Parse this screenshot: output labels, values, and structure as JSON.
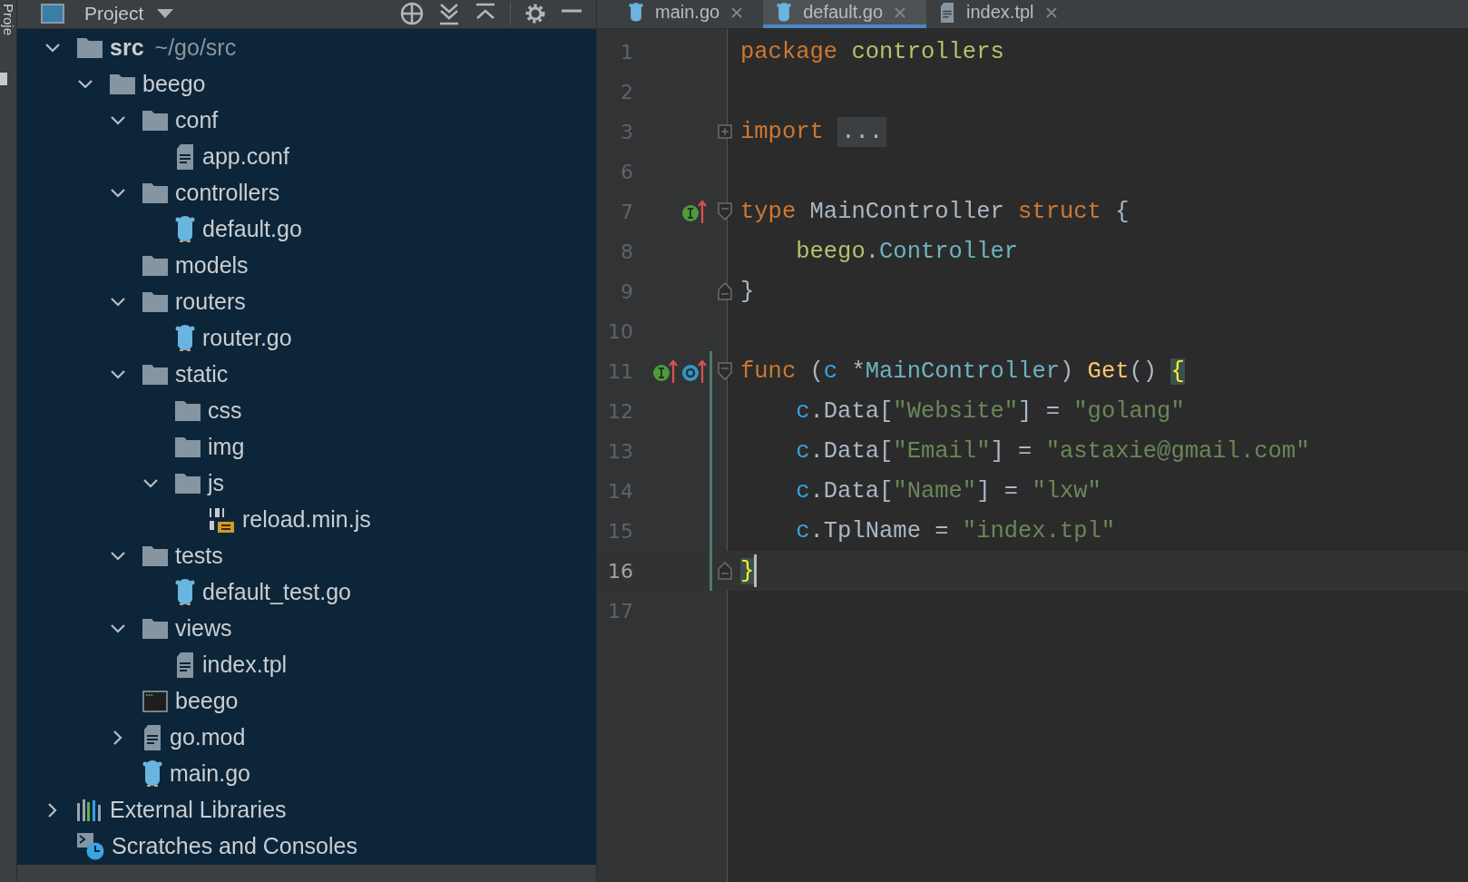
{
  "side_tab": {
    "label": "Proje"
  },
  "project_header": {
    "title": "Project"
  },
  "tree": [
    {
      "name": "src",
      "path": "~/go/src",
      "kind": "folder",
      "expanded": true,
      "children": [
        {
          "name": "beego",
          "kind": "folder",
          "expanded": true,
          "children": [
            {
              "name": "conf",
              "kind": "folder",
              "expanded": true,
              "children": [
                {
                  "name": "app.conf",
                  "kind": "text"
                }
              ]
            },
            {
              "name": "controllers",
              "kind": "folder",
              "expanded": true,
              "children": [
                {
                  "name": "default.go",
                  "kind": "go"
                }
              ]
            },
            {
              "name": "models",
              "kind": "folder"
            },
            {
              "name": "routers",
              "kind": "folder",
              "expanded": true,
              "children": [
                {
                  "name": "router.go",
                  "kind": "go"
                }
              ]
            },
            {
              "name": "static",
              "kind": "folder",
              "expanded": true,
              "children": [
                {
                  "name": "css",
                  "kind": "folder"
                },
                {
                  "name": "img",
                  "kind": "folder"
                },
                {
                  "name": "js",
                  "kind": "folder",
                  "expanded": true,
                  "children": [
                    {
                      "name": "reload.min.js",
                      "kind": "binary"
                    }
                  ]
                }
              ]
            },
            {
              "name": "tests",
              "kind": "folder",
              "expanded": true,
              "children": [
                {
                  "name": "default_test.go",
                  "kind": "go"
                }
              ]
            },
            {
              "name": "views",
              "kind": "folder",
              "expanded": true,
              "children": [
                {
                  "name": "index.tpl",
                  "kind": "text"
                }
              ]
            },
            {
              "name": "beego",
              "kind": "executable"
            },
            {
              "name": "go.mod",
              "kind": "text",
              "expanded": false
            },
            {
              "name": "main.go",
              "kind": "go"
            }
          ]
        }
      ]
    },
    {
      "name": "External Libraries",
      "kind": "libraries",
      "expanded": false
    },
    {
      "name": "Scratches and Consoles",
      "kind": "scratches"
    }
  ],
  "tabs": [
    {
      "label": "main.go",
      "kind": "go",
      "selected": false
    },
    {
      "label": "default.go",
      "kind": "go",
      "selected": true
    },
    {
      "label": "index.tpl",
      "kind": "text",
      "selected": false
    }
  ],
  "code": [
    {
      "number": "1",
      "tokens": [
        {
          "text": "package ",
          "kind": "keyword"
        },
        {
          "text": "controllers",
          "kind": "package"
        }
      ]
    },
    {
      "number": "2"
    },
    {
      "number": "3",
      "folded": true,
      "tokens": [
        {
          "text": "import ",
          "kind": "keyword"
        },
        {
          "text": "...",
          "kind": "folded"
        }
      ]
    },
    {
      "number": "6"
    },
    {
      "number": "7",
      "fold_start": true,
      "implements": true,
      "tokens": [
        {
          "text": "type",
          "kind": "keyword"
        },
        {
          "text": " MainController ",
          "kind": "plain"
        },
        {
          "text": "struct",
          "kind": "keyword"
        },
        {
          "text": " {",
          "kind": "plain"
        }
      ]
    },
    {
      "number": "8",
      "tokens": [
        {
          "text": "    beego",
          "kind": "package"
        },
        {
          "text": ".",
          "kind": "plain"
        },
        {
          "text": "Controller",
          "kind": "type_ref"
        }
      ]
    },
    {
      "number": "9",
      "fold_end": true,
      "tokens": [
        {
          "text": "}",
          "kind": "plain"
        }
      ]
    },
    {
      "number": "10"
    },
    {
      "number": "11",
      "fold_start": true,
      "changed": true,
      "implements": true,
      "overrides": true,
      "tokens": [
        {
          "text": "func",
          "kind": "keyword"
        },
        {
          "text": " (",
          "kind": "plain"
        },
        {
          "text": "c",
          "kind": "param"
        },
        {
          "text": " *",
          "kind": "plain"
        },
        {
          "text": "MainController",
          "kind": "type_ref"
        },
        {
          "text": ") ",
          "kind": "plain"
        },
        {
          "text": "Get",
          "kind": "func_name"
        },
        {
          "text": "() ",
          "kind": "plain"
        },
        {
          "text": "{",
          "kind": "brace_match"
        }
      ]
    },
    {
      "number": "12",
      "changed": true,
      "tokens": [
        {
          "text": "    c",
          "kind": "param"
        },
        {
          "text": ".Data[",
          "kind": "plain"
        },
        {
          "text": "\"Website\"",
          "kind": "string"
        },
        {
          "text": "] = ",
          "kind": "plain"
        },
        {
          "text": "\"golang\"",
          "kind": "string"
        }
      ]
    },
    {
      "number": "13",
      "changed": true,
      "tokens": [
        {
          "text": "    c",
          "kind": "param"
        },
        {
          "text": ".Data[",
          "kind": "plain"
        },
        {
          "text": "\"Email\"",
          "kind": "string"
        },
        {
          "text": "] = ",
          "kind": "plain"
        },
        {
          "text": "\"astaxie@gmail.com\"",
          "kind": "string"
        }
      ]
    },
    {
      "number": "14",
      "changed": true,
      "tokens": [
        {
          "text": "    c",
          "kind": "param"
        },
        {
          "text": ".Data[",
          "kind": "plain"
        },
        {
          "text": "\"Name\"",
          "kind": "string"
        },
        {
          "text": "] = ",
          "kind": "plain"
        },
        {
          "text": "\"lxw\"",
          "kind": "string"
        }
      ]
    },
    {
      "number": "15",
      "changed": true,
      "tokens": [
        {
          "text": "    c",
          "kind": "param"
        },
        {
          "text": ".TplName = ",
          "kind": "plain"
        },
        {
          "text": "\"index.tpl\"",
          "kind": "string"
        }
      ]
    },
    {
      "number": "16",
      "fold_end": true,
      "changed": true,
      "current": true,
      "tokens": [
        {
          "text": "}",
          "kind": "brace_match"
        }
      ]
    },
    {
      "number": "17"
    }
  ]
}
